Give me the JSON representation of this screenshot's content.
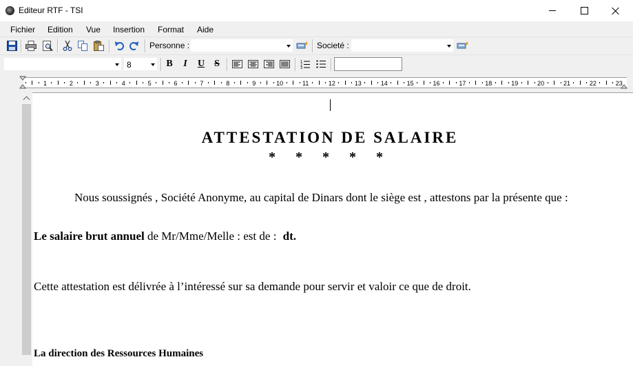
{
  "window": {
    "title": "Editeur RTF - TSI"
  },
  "menu": [
    "Fichier",
    "Edition",
    "Vue",
    "Insertion",
    "Format",
    "Aide"
  ],
  "toolbar1": {
    "icons": [
      "save-icon",
      "print-icon",
      "print-preview-icon",
      "cut-icon",
      "copy-icon",
      "paste-icon",
      "undo-icon",
      "redo-icon",
      "insert-field-icon"
    ],
    "personne_label": "Personne :",
    "personne_value": "",
    "societe_label": "Societé :",
    "societe_value": ""
  },
  "toolbar2": {
    "font_name": "",
    "font_size": "8",
    "bold_label": "B",
    "italic_label": "I",
    "underline_label": "U",
    "strike_label": "S",
    "icons": [
      "align-left-icon",
      "align-center-icon",
      "align-right-icon",
      "justify-icon",
      "numbered-list-icon",
      "bullet-list-icon"
    ],
    "extra_value": ""
  },
  "ruler": {
    "numbers": [
      "1",
      "2",
      "3",
      "4",
      "5",
      "6",
      "7",
      "8",
      "9",
      "10",
      "11",
      "12",
      "13",
      "14",
      "15",
      "16",
      "17",
      "18",
      "19",
      "20",
      "21",
      "22",
      "23"
    ]
  },
  "document": {
    "title": "ATTESTATION DE SALAIRE",
    "stars": "* * * * *",
    "intro": "Nous soussignés , Société Anonyme, au capital de Dinars dont le siège est , attestons par la présente que :",
    "salary_bold": "Le salaire brut annuel",
    "salary_text": " de Mr/Mme/Melle : est de : ",
    "salary_unit": "dt.",
    "closing": "Cette attestation est délivrée à l’intéressé sur sa demande pour servir et valoir ce que de droit.",
    "signature": "La direction des Ressources Humaines"
  },
  "colors": {
    "undo_redo": "#1f5fbf",
    "save": "#1e4fa0"
  }
}
